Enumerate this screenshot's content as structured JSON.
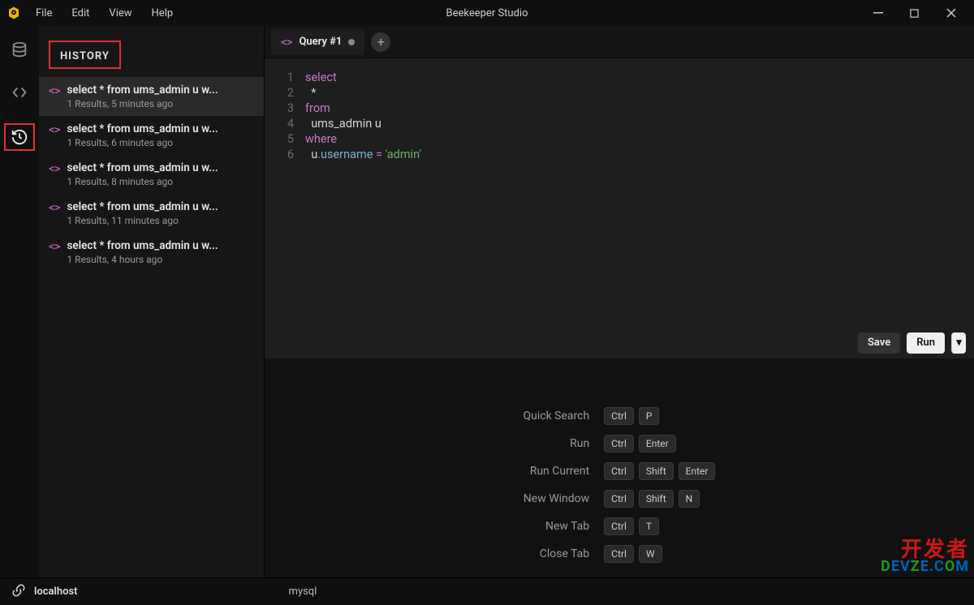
{
  "window": {
    "title": "Beekeeper Studio",
    "menus": [
      "File",
      "Edit",
      "View",
      "Help"
    ]
  },
  "sidebar": {
    "header": "HISTORY",
    "items": [
      {
        "title": "select * from ums_admin u w...",
        "sub": "1 Results, 5 minutes ago",
        "selected": true
      },
      {
        "title": "select * from ums_admin u w...",
        "sub": "1 Results, 6 minutes ago",
        "selected": false
      },
      {
        "title": "select * from ums_admin u w...",
        "sub": "1 Results, 8 minutes ago",
        "selected": false
      },
      {
        "title": "select * from ums_admin u w...",
        "sub": "1 Results, 11 minutes ago",
        "selected": false
      },
      {
        "title": "select * from ums_admin u w...",
        "sub": "1 Results, 4 hours ago",
        "selected": false
      }
    ]
  },
  "tabs": [
    {
      "label": "Query #1",
      "dirty": true
    }
  ],
  "code": [
    [
      {
        "t": "select",
        "c": "kw"
      }
    ],
    [
      {
        "t": "  *",
        "c": "plain"
      }
    ],
    [
      {
        "t": "from",
        "c": "kw"
      }
    ],
    [
      {
        "t": "  ums_admin u",
        "c": "plain"
      }
    ],
    [
      {
        "t": "where",
        "c": "kw"
      }
    ],
    [
      {
        "t": "  u",
        "c": "id"
      },
      {
        "t": ".",
        "c": "dot"
      },
      {
        "t": "username",
        "c": "field"
      },
      {
        "t": " ",
        "c": "plain"
      },
      {
        "t": "=",
        "c": "op"
      },
      {
        "t": " ",
        "c": "plain"
      },
      {
        "t": "'admin'",
        "c": "str"
      }
    ]
  ],
  "actions": {
    "save": "Save",
    "run": "Run"
  },
  "shortcuts": [
    {
      "label": "Quick Search",
      "keys": [
        "Ctrl",
        "P"
      ]
    },
    {
      "label": "Run",
      "keys": [
        "Ctrl",
        "Enter"
      ]
    },
    {
      "label": "Run Current",
      "keys": [
        "Ctrl",
        "Shift",
        "Enter"
      ]
    },
    {
      "label": "New Window",
      "keys": [
        "Ctrl",
        "Shift",
        "N"
      ]
    },
    {
      "label": "New Tab",
      "keys": [
        "Ctrl",
        "T"
      ]
    },
    {
      "label": "Close Tab",
      "keys": [
        "Ctrl",
        "W"
      ]
    }
  ],
  "status": {
    "host": "localhost",
    "engine": "mysql"
  },
  "watermark": {
    "line1": "开发者",
    "line2a": "D",
    "line2b": "EV",
    "line2c": "Z",
    "line2d": "E",
    "line2e": ".C",
    "line2f": "O",
    "line2g": "M"
  }
}
